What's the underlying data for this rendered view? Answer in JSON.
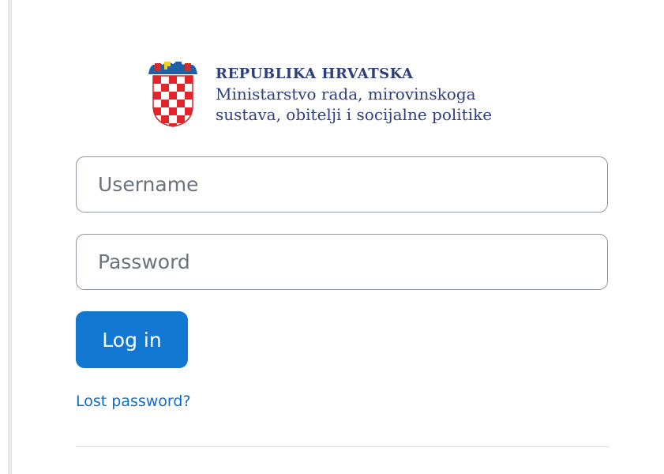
{
  "logo": {
    "line1": "REPUBLIKA HRVATSKA",
    "line2": "Ministarstvo rada, mirovinskoga",
    "line3": "sustava, obitelji i socijalne politike",
    "crest_icon": "croatian-coat-of-arms-icon"
  },
  "form": {
    "username_placeholder": "Username",
    "username_value": "",
    "password_placeholder": "Password",
    "password_value": "",
    "login_label": "Log in",
    "lost_password_label": "Lost password?"
  },
  "colors": {
    "accent": "#1177d1",
    "link": "#0f6cbf",
    "logo_text": "#2f3e7d"
  }
}
